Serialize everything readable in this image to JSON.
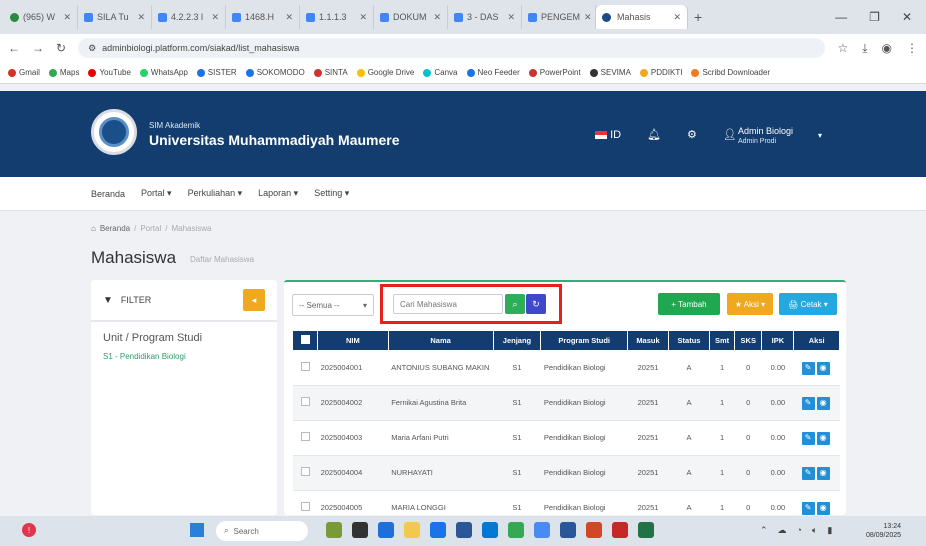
{
  "browser": {
    "tabs": [
      {
        "label": "(965) W"
      },
      {
        "label": "SILA Tu"
      },
      {
        "label": "4.2.2.3 l"
      },
      {
        "label": "1468.H"
      },
      {
        "label": "1.1.1.3"
      },
      {
        "label": "DOKUM"
      },
      {
        "label": "3 - DAS"
      },
      {
        "label": "PENGEM"
      },
      {
        "label": "Mahasis"
      }
    ],
    "url": "adminbiologi.platform.com/siakad/list_mahasiswa",
    "bookmarks": [
      "Gmail",
      "Maps",
      "YouTube",
      "WhatsApp",
      "SISTER",
      "SOKOMODO",
      "SINTA",
      "Google Drive",
      "Canva",
      "Neo Feeder",
      "PowerPoint",
      "SEVIMA",
      "PDDIKTI",
      "Scribd Downloader"
    ]
  },
  "app": {
    "subtitle": "SIM Akademik",
    "title": "Universitas Muhammadiyah Maumere",
    "lang": "ID",
    "user_name": "Admin Biologi",
    "user_role": "Admin Prodi"
  },
  "menu": [
    "Beranda",
    "Portal ▾",
    "Perkuliahan ▾",
    "Laporan ▾",
    "Setting ▾"
  ],
  "breadcrumb": {
    "home": "Beranda",
    "sep1": "/",
    "portal": "Portal",
    "sep2": "/",
    "current": "Mahasiswa"
  },
  "page": {
    "title": "Mahasiswa",
    "subtitle": "Daftar Mahasiswa"
  },
  "filter": {
    "label": "FILTER",
    "group_label": "Unit / Program Studi",
    "option": "S1 - Pendidikan Biologi"
  },
  "toolbar": {
    "select_label": "-- Semua --",
    "search_placeholder": "Cari Mahasiswa",
    "add_label": "+ Tambah",
    "aksi_label": "★ Aksi ▾",
    "print_label": "🖨 Cetak ▾"
  },
  "table": {
    "headers": [
      "",
      "NIM",
      "Nama",
      "Jenjang",
      "Program Studi",
      "Masuk",
      "Status",
      "Smt",
      "SKS",
      "IPK",
      "Aksi"
    ],
    "rows": [
      {
        "nim": "2025004001",
        "nama": "ANTONIUS SUBANG MAKIN",
        "jenjang": "S1",
        "prodi": "Pendidikan Biologi",
        "masuk": "20251",
        "status": "A",
        "smt": "1",
        "sks": "0",
        "ipk": "0.00"
      },
      {
        "nim": "2025004002",
        "nama": "Fernikai Agustina Brita",
        "jenjang": "S1",
        "prodi": "Pendidikan Biologi",
        "masuk": "20251",
        "status": "A",
        "smt": "1",
        "sks": "0",
        "ipk": "0.00"
      },
      {
        "nim": "2025004003",
        "nama": "Maria Arfani Putri",
        "jenjang": "S1",
        "prodi": "Pendidikan Biologi",
        "masuk": "20251",
        "status": "A",
        "smt": "1",
        "sks": "0",
        "ipk": "0.00"
      },
      {
        "nim": "2025004004",
        "nama": "NURHAYATI",
        "jenjang": "S1",
        "prodi": "Pendidikan Biologi",
        "masuk": "20251",
        "status": "A",
        "smt": "1",
        "sks": "0",
        "ipk": "0.00"
      },
      {
        "nim": "2025004005",
        "nama": "MARIA LONGGI",
        "jenjang": "S1",
        "prodi": "Pendidikan Biologi",
        "masuk": "20251",
        "status": "A",
        "smt": "1",
        "sks": "0",
        "ipk": "0.00"
      }
    ]
  },
  "taskbar": {
    "search_label": "Search",
    "time": "13:24",
    "date": "08/09/2025"
  },
  "colors": {
    "header": "#123d6e",
    "accent_green": "#2fae7a",
    "highlight_red": "#e61f1f",
    "warning": "#f0a91e",
    "info": "#24a8e0"
  }
}
